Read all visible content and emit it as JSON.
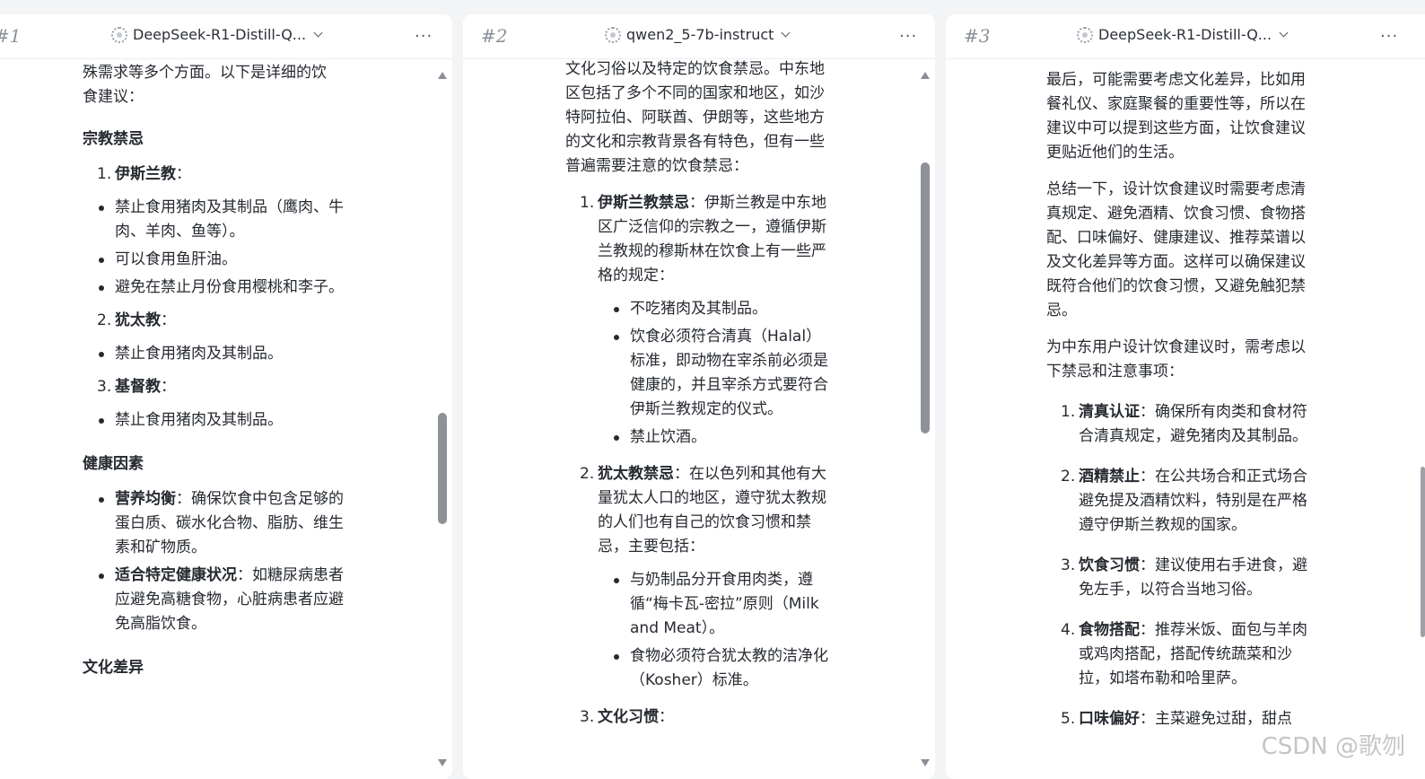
{
  "panels": [
    {
      "num": "#1",
      "model": "DeepSeek-R1-Distill-Q...",
      "more": "···",
      "intro": [
        "殊需求等多个方面。以下是详细的饮",
        "食建议："
      ],
      "sec1": "宗教禁忌",
      "islam": "伊斯兰教",
      "islam_items": [
        "禁止食用猪肉及其制品（鹰肉、牛肉、羊肉、鱼等）。",
        "可以食用鱼肝油。",
        "避免在禁止月份食用樱桃和李子。"
      ],
      "judaism": "犹太教",
      "judaism_items": [
        "禁止食用猪肉及其制品。"
      ],
      "christian": "基督教",
      "christian_items": [
        "禁止食用猪肉及其制品。"
      ],
      "sec2": "健康因素",
      "health": [
        {
          "title": "营养均衡",
          "text": "：确保饮食中包含足够的蛋白质、碳水化合物、脂肪、维生素和矿物质。"
        },
        {
          "title": "适合特定健康状况",
          "text": "：如糖尿病患者应避免高糖食物，心脏病患者应避免高脂饮食。"
        }
      ],
      "sec3": "文化差异",
      "colon": "："
    },
    {
      "num": "#2",
      "model": "qwen2_5-7b-instruct",
      "more": "···",
      "intro": "文化习俗以及特定的饮食禁忌。中东地区包括了多个不同的国家和地区，如沙特阿拉伯、阿联酋、伊朗等，这些地方的文化和宗教背景各有特色，但有一些普遍需要注意的饮食禁忌：",
      "items": [
        {
          "n": "1.",
          "title": "伊斯兰教禁忌",
          "text": "：伊斯兰教是中东地区广泛信仰的宗教之一，遵循伊斯兰教规的穆斯林在饮食上有一些严格的规定：",
          "subs": [
            "不吃猪肉及其制品。",
            "饮食必须符合清真（Halal）标准，即动物在宰杀前必须是健康的，并且宰杀方式要符合伊斯兰教规定的仪式。",
            "禁止饮酒。"
          ]
        },
        {
          "n": "2.",
          "title": "犹太教禁忌",
          "text": "：在以色列和其他有大量犹太人口的地区，遵守犹太教规的人们也有自己的饮食习惯和禁忌，主要包括：",
          "subs": [
            "与奶制品分开食用肉类，遵循“梅卡瓦-密拉”原则（Milk and Meat）。",
            "食物必须符合犹太教的洁净化（Kosher）标准。"
          ]
        },
        {
          "n": "3.",
          "title": "文化习惯",
          "text": "：",
          "subs": []
        }
      ]
    },
    {
      "num": "#3",
      "model": "DeepSeek-R1-Distill-Q...",
      "more": "···",
      "p1": "最后，可能需要考虑文化差异，比如用餐礼仪、家庭聚餐的重要性等，所以在建议中可以提到这些方面，让饮食建议更贴近他们的生活。",
      "p2": "总结一下，设计饮食建议时需要考虑清真规定、避免酒精、饮食习惯、食物搭配、口味偏好、健康建议、推荐菜谱以及文化差异等方面。这样可以确保建议既符合他们的饮食习惯，又避免触犯禁忌。",
      "p3": "为中东用户设计饮食建议时，需考虑以下禁忌和注意事项：",
      "items": [
        {
          "n": "1.",
          "title": "清真认证",
          "text": "：确保所有肉类和食材符合清真规定，避免猪肉及其制品。"
        },
        {
          "n": "2.",
          "title": "酒精禁止",
          "text": "：在公共场合和正式场合避免提及酒精饮料，特别是在严格遵守伊斯兰教规的国家。"
        },
        {
          "n": "3.",
          "title": "饮食习惯",
          "text": "：建议使用右手进食，避免左手，以符合当地习俗。"
        },
        {
          "n": "4.",
          "title": "食物搭配",
          "text": "：推荐米饭、面包与羊肉或鸡肉搭配，搭配传统蔬菜和沙拉，如塔布勒和哈里萨。"
        },
        {
          "n": "5.",
          "title": "口味偏好",
          "text": "：主菜避免过甜，甜点"
        }
      ]
    }
  ],
  "watermark": "CSDN @歌刎"
}
